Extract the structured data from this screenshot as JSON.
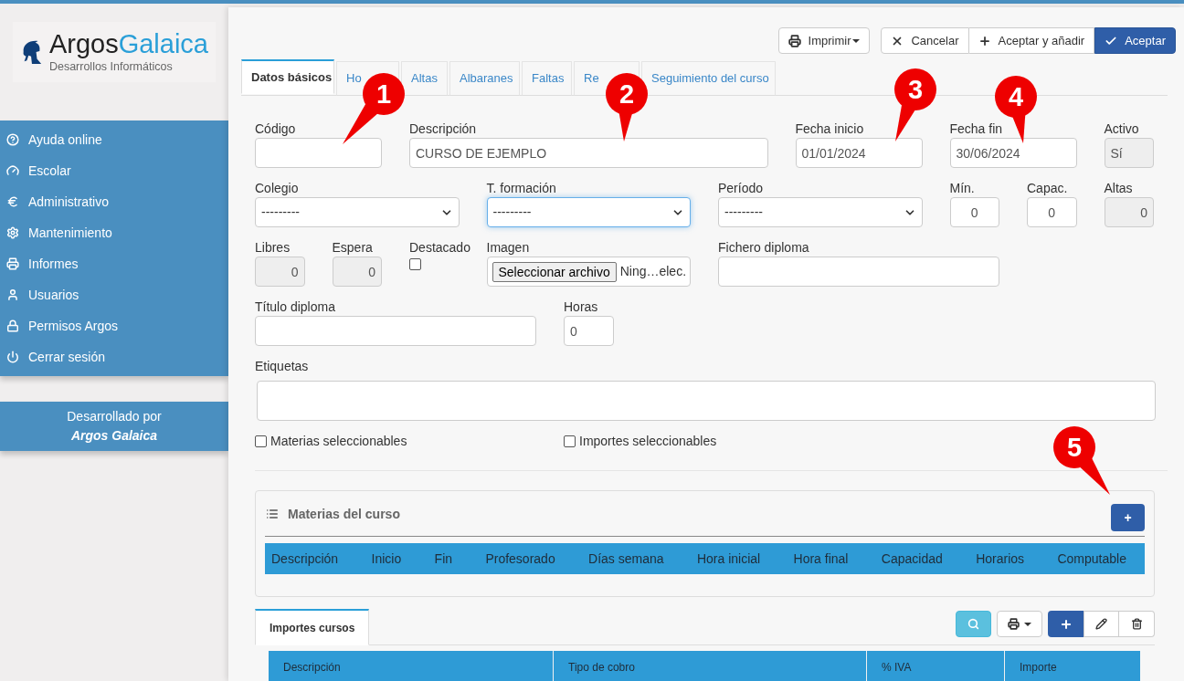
{
  "logo": {
    "name_part1": "Argos",
    "name_part2": "Galaica",
    "tagline": "Desarrollos Informáticos"
  },
  "sidebar": {
    "items": [
      {
        "label": "Ayuda online"
      },
      {
        "label": "Escolar"
      },
      {
        "label": "Administrativo"
      },
      {
        "label": "Mantenimiento"
      },
      {
        "label": "Informes"
      },
      {
        "label": "Usuarios"
      },
      {
        "label": "Permisos Argos"
      },
      {
        "label": "Cerrar sesión"
      }
    ],
    "footer": {
      "line1": "Desarrollado por",
      "line2": "Argos Galaica"
    }
  },
  "toolbar": [
    {
      "kind": "print",
      "label": "Imprimir"
    },
    {
      "kind": "cancel",
      "label": "Cancelar"
    },
    {
      "kind": "add",
      "label": "Aceptar y añadir"
    },
    {
      "kind": "accept",
      "label": "Aceptar"
    }
  ],
  "tabs": [
    {
      "label": "Datos básicos",
      "selected": true
    },
    {
      "label": "Ho",
      "selected": false
    },
    {
      "label": "Altas",
      "selected": false
    },
    {
      "label": "Albaranes",
      "selected": false
    },
    {
      "label": "Faltas",
      "selected": false
    },
    {
      "label": "Re",
      "selected": false
    },
    {
      "label": "Seguimiento del curso",
      "selected": false
    }
  ],
  "form_rows": [
    [
      {
        "kind": "text",
        "label": "Código",
        "disabled": false
      },
      {
        "kind": "text",
        "label": "Descripción",
        "value": "CURSO DE EJEMPLO",
        "disabled": false
      },
      {
        "kind": "text",
        "label": "Fecha inicio",
        "value": "01/01/2024",
        "disabled": false
      },
      {
        "kind": "text",
        "label": "Fecha fin",
        "value": "30/06/2024",
        "disabled": false
      },
      {
        "kind": "text",
        "label": "Activo",
        "value": "Sí",
        "disabled": true
      }
    ],
    [
      {
        "kind": "select",
        "label": "Colegio",
        "value": "---------",
        "focused": false
      },
      {
        "kind": "select",
        "label": "T. formación",
        "value": "---------",
        "focused": true
      },
      {
        "kind": "select",
        "label": "Período",
        "value": "---------",
        "focused": false
      },
      {
        "kind": "text",
        "label": "Mín.",
        "value": "0",
        "disabled": false
      },
      {
        "kind": "text",
        "label": "Capac.",
        "value": "0",
        "disabled": false
      },
      {
        "kind": "text",
        "label": "Altas",
        "value": "0",
        "disabled": true
      }
    ],
    [
      {
        "kind": "text",
        "label": "Libres",
        "value": "0",
        "disabled": true
      },
      {
        "kind": "text",
        "label": "Espera",
        "value": "0",
        "disabled": true
      },
      {
        "kind": "checkbox",
        "label": "Destacado",
        "checked": false
      },
      {
        "kind": "file",
        "label": "Imagen",
        "button": "Seleccionar archivo",
        "filename": "Ning…elec."
      },
      {
        "kind": "text",
        "label": "Fichero diploma",
        "disabled": false
      }
    ],
    [
      {
        "kind": "text",
        "label": "Título diploma",
        "disabled": false
      },
      {
        "kind": "text",
        "label": "Horas",
        "value": "0",
        "disabled": false
      }
    ],
    [
      {
        "kind": "textarea",
        "label": "Etiquetas"
      }
    ]
  ],
  "options": [
    {
      "label": "Materias seleccionables",
      "checked": false
    },
    {
      "label": "Importes seleccionables",
      "checked": false
    }
  ],
  "materias": {
    "title": "Materias del curso",
    "add_button": "+",
    "columns": [
      "Descripción",
      "Inicio",
      "Fin",
      "Profesorado",
      "Días semana",
      "Hora inicial",
      "Hora final",
      "Capacidad",
      "Horarios",
      "Computable"
    ]
  },
  "importes": {
    "tab": {
      "label": "Importes cursos",
      "selected": true
    },
    "columns": [
      "Descripción",
      "Tipo de cobro",
      "% IVA",
      "Importe"
    ]
  },
  "callouts": [
    {
      "label": "1"
    },
    {
      "label": "2"
    },
    {
      "label": "3"
    },
    {
      "label": "4"
    },
    {
      "label": "5"
    }
  ]
}
